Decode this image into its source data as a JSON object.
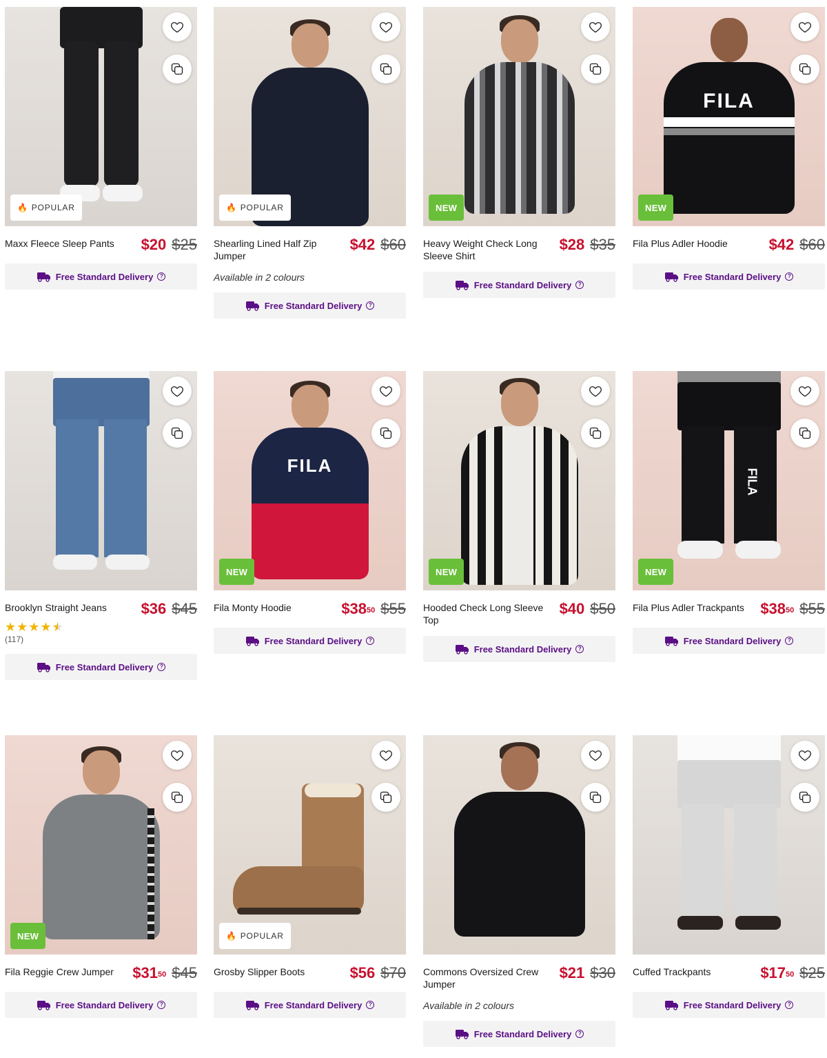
{
  "colors": {
    "price_red": "#c8102e",
    "delivery_purple": "#5b0f84",
    "new_badge_green": "#6abf3a",
    "star_gold": "#f0b400"
  },
  "icons": {
    "favourite": "heart-outline-icon",
    "compare": "stacked-squares-icon",
    "delivery": "truck-icon",
    "help": "question-circle-icon",
    "popular": "flame-icon"
  },
  "products": [
    {
      "name": "Maxx Fleece Sleep Pants",
      "price_main": "$20",
      "price_cents": "",
      "was": "$25",
      "badge": "POPULAR",
      "delivery": "Free Standard Delivery"
    },
    {
      "name": "Shearling Lined Half Zip Jumper",
      "price_main": "$42",
      "price_cents": "",
      "was": "$60",
      "badge": "POPULAR",
      "colours": "Available in 2 colours",
      "delivery": "Free Standard Delivery"
    },
    {
      "name": "Heavy Weight Check Long Sleeve Shirt",
      "price_main": "$28",
      "price_cents": "",
      "was": "$35",
      "badge": "NEW",
      "delivery": "Free Standard Delivery"
    },
    {
      "name": "Fila Plus Adler Hoodie",
      "price_main": "$42",
      "price_cents": "",
      "was": "$60",
      "badge": "NEW",
      "delivery": "Free Standard Delivery"
    },
    {
      "name": "Brooklyn Straight Jeans",
      "price_main": "$36",
      "price_cents": "",
      "was": "$45",
      "badge": "",
      "rating": 4.5,
      "reviews": "(117)",
      "delivery": "Free Standard Delivery"
    },
    {
      "name": "Fila Monty Hoodie",
      "price_main": "$38",
      "price_cents": "50",
      "was": "$55",
      "badge": "NEW",
      "delivery": "Free Standard Delivery"
    },
    {
      "name": "Hooded Check Long Sleeve Top",
      "price_main": "$40",
      "price_cents": "",
      "was": "$50",
      "badge": "NEW",
      "delivery": "Free Standard Delivery"
    },
    {
      "name": "Fila Plus Adler Trackpants",
      "price_main": "$38",
      "price_cents": "50",
      "was": "$55",
      "badge": "NEW",
      "delivery": "Free Standard Delivery"
    },
    {
      "name": "Fila Reggie Crew Jumper",
      "price_main": "$31",
      "price_cents": "50",
      "was": "$45",
      "badge": "NEW",
      "delivery": "Free Standard Delivery"
    },
    {
      "name": "Grosby Slipper Boots",
      "price_main": "$56",
      "price_cents": "",
      "was": "$70",
      "badge": "POPULAR",
      "delivery": "Free Standard Delivery"
    },
    {
      "name": "Commons Oversized Crew Jumper",
      "price_main": "$21",
      "price_cents": "",
      "was": "$30",
      "badge": "",
      "colours": "Available in 2 colours",
      "delivery": "Free Standard Delivery"
    },
    {
      "name": "Cuffed Trackpants",
      "price_main": "$17",
      "price_cents": "50",
      "was": "$25",
      "badge": "",
      "delivery": "Free Standard Delivery"
    }
  ]
}
